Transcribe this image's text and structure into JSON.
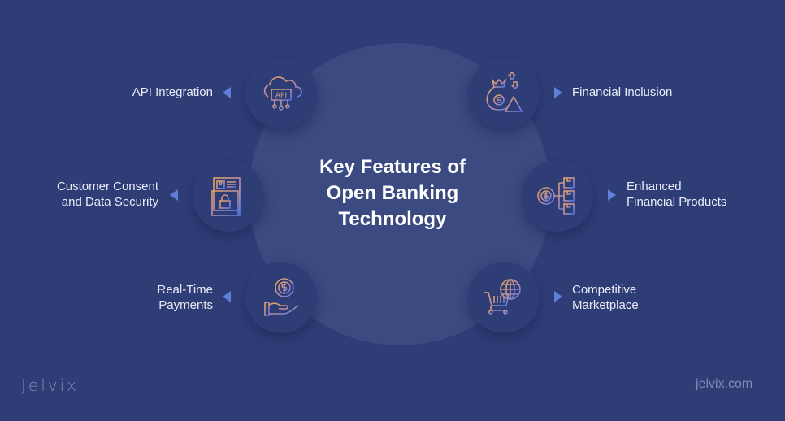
{
  "title": {
    "line1": "Key Features of",
    "line2": "Open Banking",
    "line3": "Technology"
  },
  "features": [
    {
      "id": "api-integration",
      "lines": [
        "API Integration"
      ],
      "icon": "cloud-api-icon",
      "side": "left"
    },
    {
      "id": "customer-consent",
      "lines": [
        "Customer Consent",
        "and Data Security"
      ],
      "icon": "document-lock-icon",
      "side": "left"
    },
    {
      "id": "real-time-payments",
      "lines": [
        "Real-Time",
        "Payments"
      ],
      "icon": "hand-coin-icon",
      "side": "left"
    },
    {
      "id": "financial-inclusion",
      "lines": [
        "Financial Inclusion"
      ],
      "icon": "money-bag-warning-icon",
      "side": "right"
    },
    {
      "id": "enhanced-financial-products",
      "lines": [
        "Enhanced",
        "Financial Products"
      ],
      "icon": "coin-boxes-icon",
      "side": "right"
    },
    {
      "id": "competitive-marketplace",
      "lines": [
        "Competitive",
        "Marketplace"
      ],
      "icon": "cart-globe-icon",
      "side": "right"
    }
  ],
  "icon_text": {
    "api": "API"
  },
  "footer": {
    "logo": "Jelvix",
    "site": "jelvix.com"
  },
  "colors": {
    "background": "#2f3d77",
    "circle": "#3b4a80",
    "icon_orange": "#e0a25e",
    "icon_blue": "#5f7fd8"
  }
}
